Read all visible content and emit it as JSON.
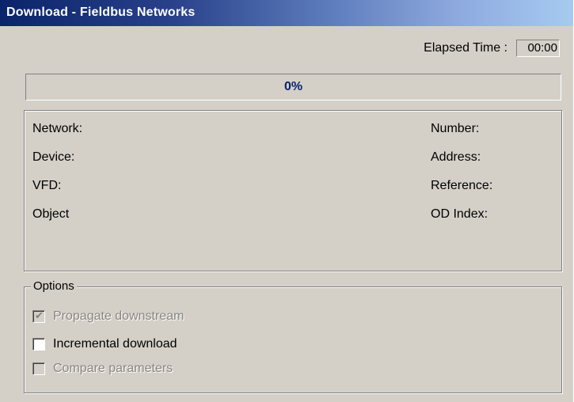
{
  "window": {
    "title": "Download - Fieldbus Networks"
  },
  "elapsed": {
    "label": "Elapsed Time :",
    "value": "00:00"
  },
  "progress": {
    "text": "0%",
    "fraction": 0
  },
  "info": {
    "left_labels": [
      "Network:",
      "Device:",
      "VFD:",
      "Object"
    ],
    "right_labels": [
      "Number:",
      "Address:",
      "Reference:",
      "OD Index:"
    ]
  },
  "options": {
    "legend": "Options",
    "items": [
      {
        "label": "Propagate downstream",
        "checked": true,
        "enabled": false
      },
      {
        "label": "Incremental download",
        "checked": false,
        "enabled": true
      },
      {
        "label": "Compare parameters",
        "checked": false,
        "enabled": false
      }
    ]
  }
}
